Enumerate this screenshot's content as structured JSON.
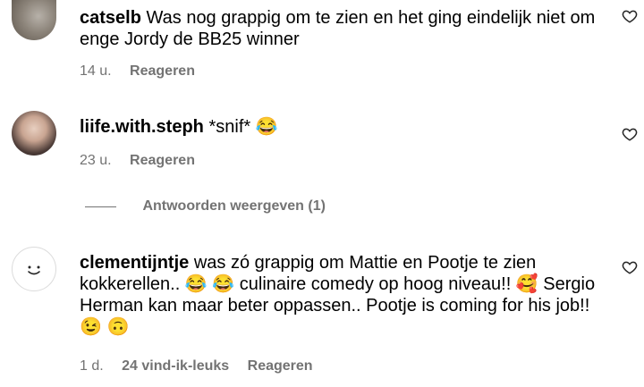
{
  "comments": [
    {
      "username": "catselb",
      "text": "Was nog grappig om te zien en het ging eindelijk niet om enge Jordy de BB25 winner",
      "time": "14 u.",
      "reply_label": "Reageren",
      "like_icon": "heart-outline-icon"
    },
    {
      "username": "liife.with.steph",
      "text": "*snif* 😂",
      "time": "23 u.",
      "reply_label": "Reageren",
      "like_icon": "heart-outline-icon"
    },
    {
      "username": "clementijntje",
      "text": "was zó grappig om Mattie en Pootje te zien kokkerellen.. 😂 😂 culinaire comedy op hoog niveau!! 🥰 Sergio Herman kan maar beter oppassen.. Pootje is coming for his job!! 😉 🙃",
      "time": "1 d.",
      "likes": "24 vind-ik-leuks",
      "reply_label": "Reageren",
      "like_icon": "heart-outline-icon"
    }
  ],
  "replies_toggle": {
    "label": "Antwoorden weergeven (1)"
  }
}
